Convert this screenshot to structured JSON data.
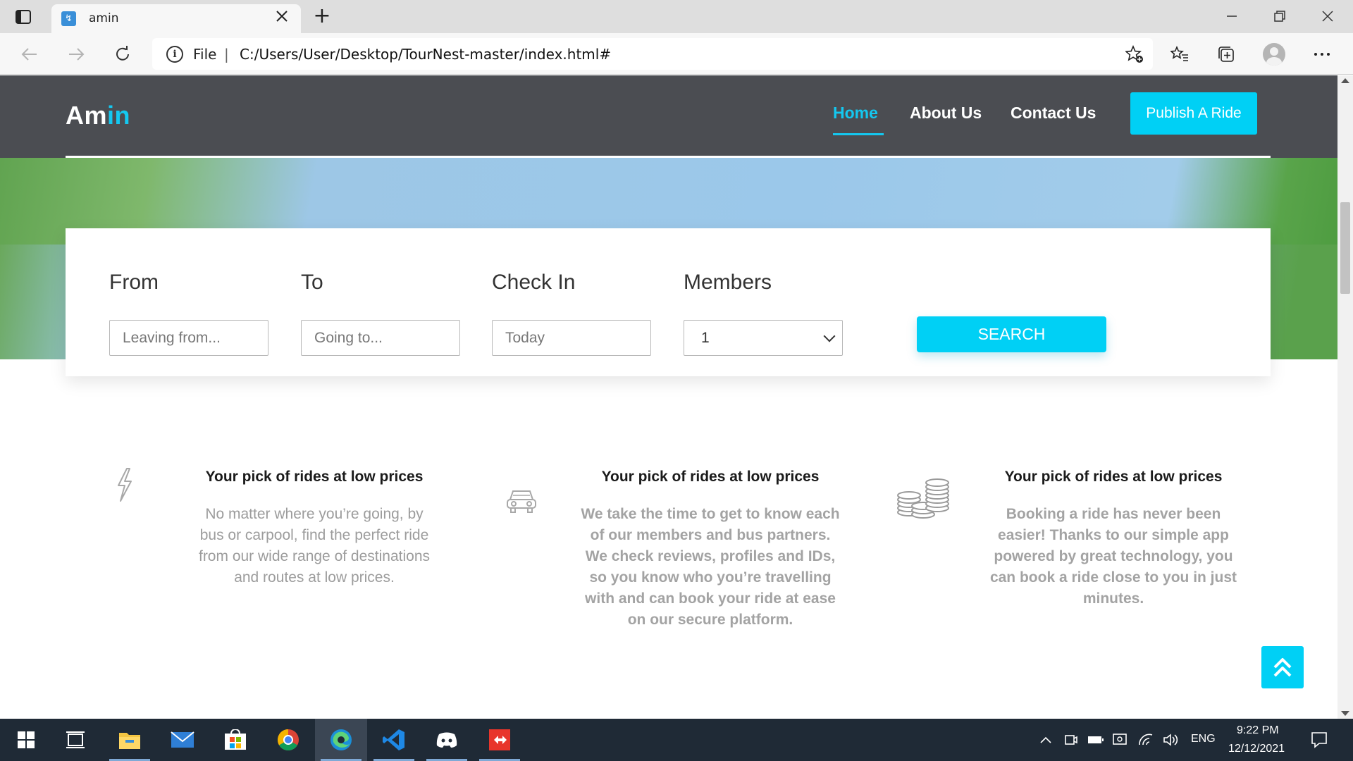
{
  "browser": {
    "tab_title": "amin",
    "new_tab_symbol": "+",
    "address": {
      "scheme_label": "File",
      "separator": "|",
      "url": "C:/Users/User/Desktop/TourNest-master/index.html#"
    }
  },
  "site": {
    "logo_main": "Am",
    "logo_accent": "in",
    "nav": [
      {
        "label": "Home",
        "active": true
      },
      {
        "label": "About Us",
        "active": false
      },
      {
        "label": "Contact Us",
        "active": false
      }
    ],
    "publish_button": "Publish A Ride",
    "accent_color": "#14c8f0",
    "header_color": "#4b4d52"
  },
  "search": {
    "fields": [
      {
        "label": "From",
        "placeholder": "Leaving from..."
      },
      {
        "label": "To",
        "placeholder": "Going to..."
      },
      {
        "label": "Check In",
        "placeholder": "Today"
      },
      {
        "label": "Members",
        "value": "1"
      }
    ],
    "button": "SEARCH"
  },
  "features": [
    {
      "icon": "lightning-icon",
      "title": "Your pick of rides at low prices",
      "lines": [
        "No matter where you’re going, by",
        "bus or carpool, find the perfect ride",
        "from our wide range of destinations",
        "and routes at low prices."
      ]
    },
    {
      "icon": "car-icon",
      "title": "Your pick of rides at low prices",
      "lines": [
        "We take the time to get to know each",
        "of our members and bus partners.",
        "We check reviews, profiles and IDs,",
        "so you know who you’re travelling",
        "with and can book your ride at ease",
        "on our secure platform."
      ]
    },
    {
      "icon": "coins-icon",
      "title": "Your pick of rides at low prices",
      "lines": [
        "Booking a ride has never been",
        "easier! Thanks to our simple app",
        "powered by great technology, you",
        "can book a ride close to you in just",
        "minutes."
      ]
    }
  ],
  "taskbar": {
    "language": "ENG",
    "time": "9:22 PM",
    "date": "12/12/2021"
  }
}
